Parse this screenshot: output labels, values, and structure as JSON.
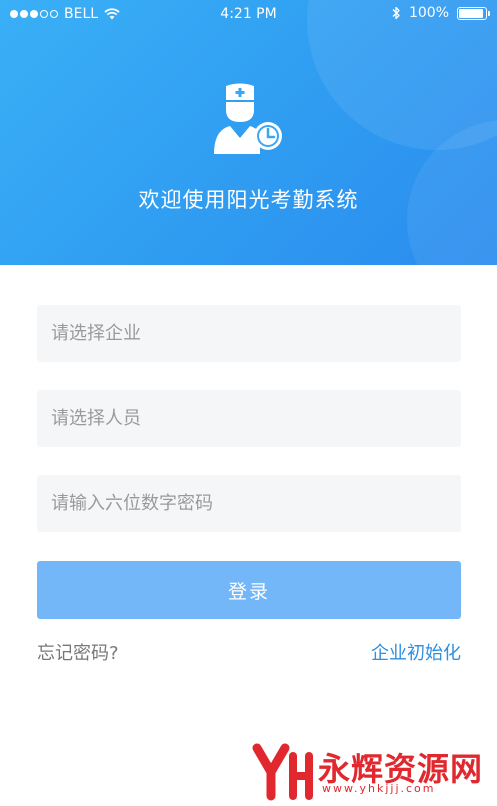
{
  "status_bar": {
    "carrier": "BELL",
    "time": "4:21 PM",
    "battery": "100%",
    "battery_level": 1.0
  },
  "header": {
    "welcome": "欢迎使用阳光考勤系统",
    "logo_icon": "doctor-clock-icon"
  },
  "form": {
    "company_placeholder": "请选择企业",
    "company_value": "",
    "person_placeholder": "请选择人员",
    "person_value": "",
    "password_placeholder": "请输入六位数字密码",
    "password_value": "",
    "login_label": "登录"
  },
  "links": {
    "forgot_password": "忘记密码?",
    "company_init": "企业初始化"
  },
  "watermark": {
    "name": "永辉资源网",
    "url": "www.yhkjjj.com"
  },
  "colors": {
    "header_gradient_start": "#3ab0f6",
    "header_gradient_end": "#2b8cee",
    "button": "#74b7f9",
    "link": "#2f8fdf",
    "field_bg": "#f5f6f7",
    "watermark": "#e0282e"
  }
}
